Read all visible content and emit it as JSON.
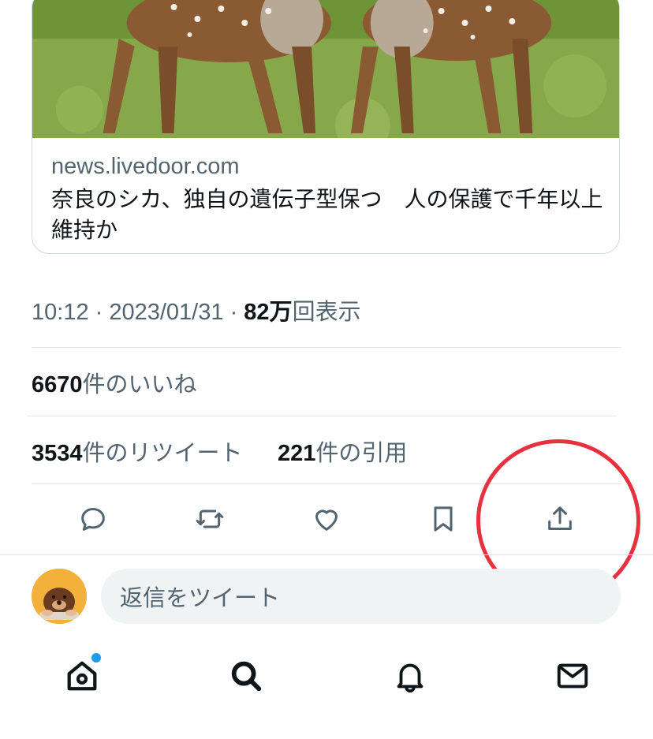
{
  "card": {
    "domain": "news.livedoor.com",
    "title": "奈良のシカ、独自の遺伝子型保つ　人の保護で千年以上維持か"
  },
  "meta": {
    "time": "10:12",
    "sep1": " · ",
    "date": "2023/01/31",
    "sep2": " · ",
    "views_count": "82万",
    "views_label": "回表示"
  },
  "stats": {
    "likes_count": "6670",
    "likes_label": "件のいいね",
    "retweets_count": "3534",
    "retweets_label": "件のリツイート",
    "quotes_count": "221",
    "quotes_label": "件の引用"
  },
  "actions": [
    {
      "icon": "reply-icon"
    },
    {
      "icon": "retweet-icon"
    },
    {
      "icon": "like-icon"
    },
    {
      "icon": "bookmark-icon"
    },
    {
      "icon": "share-icon"
    }
  ],
  "reply": {
    "placeholder": "返信をツイート"
  },
  "tabbar": [
    {
      "icon": "home-icon",
      "has_notification": true
    },
    {
      "icon": "search-icon"
    },
    {
      "icon": "notifications-icon"
    },
    {
      "icon": "messages-icon"
    }
  ],
  "colors": {
    "accent": "#1d9bf0",
    "highlight": "#e6323f",
    "text_secondary": "#536471",
    "avatar_bg": "#f3b13c"
  }
}
